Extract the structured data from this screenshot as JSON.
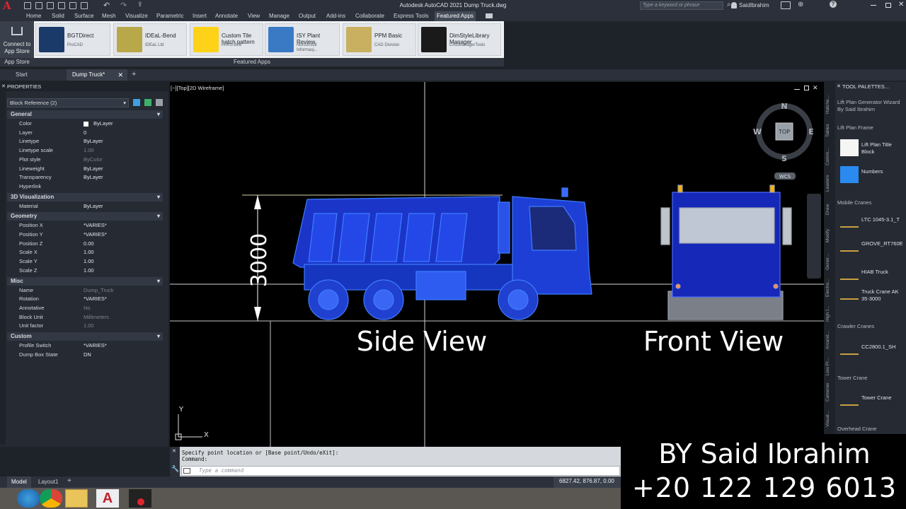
{
  "titlebar": {
    "app_title": "Autodesk AutoCAD 2021    Dump Truck.dwg",
    "search_placeholder": "Type a keyword or phrase",
    "user": "SaidIbrahim"
  },
  "menu": [
    "Home",
    "Solid",
    "Surface",
    "Mesh",
    "Visualize",
    "Parametric",
    "Insert",
    "Annotate",
    "View",
    "Manage",
    "Output",
    "Add-ins",
    "Collaborate",
    "Express Tools",
    "Featured Apps"
  ],
  "active_menu": "Featured Apps",
  "ribbon": {
    "app_store": {
      "line1": "Connect to",
      "line2": "App Store",
      "footer": "App Store"
    },
    "footer": "Featured Apps",
    "apps": [
      {
        "name": "BGTDirect",
        "sub": "ProCAD"
      },
      {
        "name": "IDEaL-Bend",
        "sub": "IDEaL Ltd"
      },
      {
        "name": "Custom Tile hatch pattern",
        "sub": "PARS-BIM"
      },
      {
        "name": "ISY Plant Review",
        "sub": "Norconsult Informasj..."
      },
      {
        "name": "PPM Basic",
        "sub": "CAD Division"
      },
      {
        "name": "DimStyleLibrary Manager",
        "sub": "CADManagerTools"
      }
    ]
  },
  "filetabs": [
    "Start",
    "Dump Truck*"
  ],
  "properties": {
    "title": "PROPERTIES",
    "selection": "Block Reference (2)",
    "sections": [
      {
        "name": "General",
        "rows": [
          [
            "Color",
            "ByLayer"
          ],
          [
            "Layer",
            "0"
          ],
          [
            "Linetype",
            "ByLayer"
          ],
          [
            "Linetype scale",
            "1.00"
          ],
          [
            "Plot style",
            "ByColor"
          ],
          [
            "Lineweight",
            "ByLayer"
          ],
          [
            "Transparency",
            "ByLayer"
          ],
          [
            "Hyperlink",
            ""
          ]
        ]
      },
      {
        "name": "3D Visualization",
        "rows": [
          [
            "Material",
            "ByLayer"
          ]
        ]
      },
      {
        "name": "Geometry",
        "rows": [
          [
            "Position X",
            "*VARIES*"
          ],
          [
            "Position Y",
            "*VARIES*"
          ],
          [
            "Position Z",
            "0.00"
          ],
          [
            "Scale X",
            "1.00"
          ],
          [
            "Scale Y",
            "1.00"
          ],
          [
            "Scale Z",
            "1.00"
          ]
        ]
      },
      {
        "name": "Misc",
        "rows": [
          [
            "Name",
            "Dump_Truck"
          ],
          [
            "Rotation",
            "*VARIES*"
          ],
          [
            "Annotative",
            "No"
          ],
          [
            "Block Unit",
            "Millimeters"
          ],
          [
            "Unit factor",
            "1.00"
          ]
        ]
      },
      {
        "name": "Custom",
        "rows": [
          [
            "Profile Switch",
            "*VARIES*"
          ],
          [
            "Dump Box State",
            "DN"
          ]
        ]
      }
    ]
  },
  "viewport": {
    "label": "[−][Top][2D Wireframe]",
    "dimension": "3000",
    "side_view": "Side View",
    "front_view": "Front View",
    "viewcube": {
      "top": "TOP",
      "n": "N",
      "s": "S",
      "e": "E",
      "w": "W",
      "wcs": "WCS"
    },
    "ucs_x": "X",
    "ucs_y": "Y"
  },
  "tool_palettes": {
    "title": "TOOL PALETTES...",
    "side_tabs": [
      "Hatche...",
      "Tables",
      "Comm...",
      "Leaders",
      "Draw",
      "Modify",
      "Gener...",
      "Electro...",
      "High I...",
      "Arcand...",
      "Low Pr...",
      "Cameras",
      "Visual..."
    ],
    "items": [
      {
        "type": "header",
        "text": "Lift Plan Generator Wizard By Said Ibrahim"
      },
      {
        "type": "header",
        "text": "Lift Plan Frame"
      },
      {
        "type": "tool",
        "text": "Lift Plan Title Block"
      },
      {
        "type": "tool",
        "text": "Numbers"
      },
      {
        "type": "header",
        "text": "Mobile Cranes"
      },
      {
        "type": "tool",
        "text": "LTC 1045-3.1_T"
      },
      {
        "type": "tool",
        "text": "GROVE_RT760E"
      },
      {
        "type": "tool",
        "text": "HIAB Truck"
      },
      {
        "type": "tool",
        "text": "Truck Crane AK 35-3000"
      },
      {
        "type": "header",
        "text": "Crawler Cranes"
      },
      {
        "type": "tool",
        "text": "CC2800.1_SH"
      },
      {
        "type": "header",
        "text": "Tower Crane"
      },
      {
        "type": "tool",
        "text": "Tower Crane"
      },
      {
        "type": "header",
        "text": "Overhead Crane"
      }
    ]
  },
  "command": {
    "history1": "Specify point location or [Base point/Undo/eXit]:",
    "history2": "Command:",
    "placeholder": "Type a command"
  },
  "layouts": [
    "Model",
    "Layout1"
  ],
  "coords": "6827.42, 876.87, 0.00",
  "watermark": {
    "line1": "BY Said Ibrahim",
    "line2": "+20 122 129 6013"
  }
}
